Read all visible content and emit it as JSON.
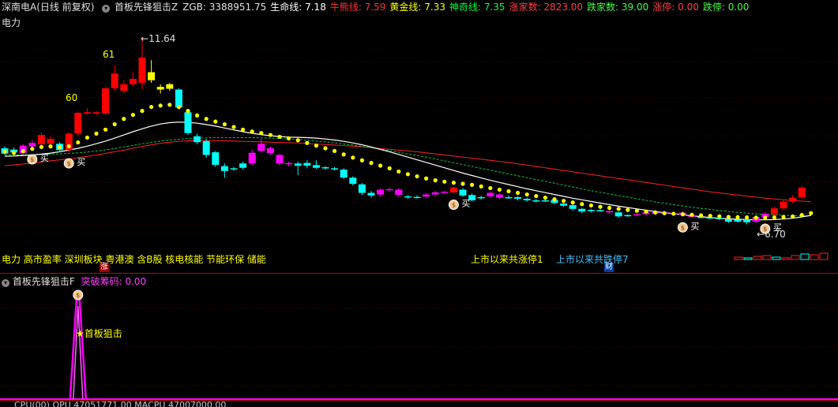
{
  "header": {
    "stock": "深南电A(日线 前复权)",
    "indicator_title": "首板先锋狙击Z",
    "items": [
      {
        "label": "ZGB:",
        "value": "3388951.75",
        "color": "#e0e0e0"
      },
      {
        "label": "生命线:",
        "value": "7.18",
        "color": "#ffffff"
      },
      {
        "label": "牛熊线:",
        "value": "7.59",
        "color": "#ff3030"
      },
      {
        "label": "黄金线:",
        "value": "7.33",
        "color": "#ffff00"
      },
      {
        "label": "神奇线:",
        "value": "7.35",
        "color": "#00ff40"
      },
      {
        "label": "涨家数:",
        "value": "2823.00",
        "color": "#ff4040"
      },
      {
        "label": "跌家数:",
        "value": "39.00",
        "color": "#40ff40"
      },
      {
        "label": "涨停:",
        "value": "0.00",
        "color": "#ff4040"
      },
      {
        "label": "跌停:",
        "value": "0.00",
        "color": "#40ff40"
      }
    ]
  },
  "sector_label": "电力",
  "concepts": "电力 高市盈率 深圳板块 粤港澳 含B股 核电核能 节能环保 储能",
  "limit_up_text": "上市以来共涨停1",
  "limit_down_text": "上市以来共跌停7",
  "zhang_badge": "涨",
  "cai_badge": "财",
  "annotations": {
    "high_label": "11.64",
    "low_label": "6.70",
    "label_61": "61",
    "label_60": "60",
    "buy": "买"
  },
  "sub_panel": {
    "title": "首板先锋狙击F",
    "item_label": "突破筹码:",
    "item_value": "0.00",
    "signal_label": "首板狙击"
  },
  "bottom_cut_text": "CPU(00) OPU 47051771.00 MACPU 47007000.00",
  "colors": {
    "up": "#ff0000",
    "down": "#00ffff",
    "magenta": "#ff00ff",
    "yellow": "#ffff00",
    "life_line": "#ffffff",
    "bull_bear": "#ff2020",
    "magic": "#00cc40",
    "separator": "#c80000"
  },
  "chart_data": {
    "type": "candlestick",
    "candles": [
      {
        "o": 7.35,
        "c": 7.55,
        "h": 7.62,
        "l": 7.3,
        "col": "cyan"
      },
      {
        "o": 7.5,
        "c": 7.4,
        "h": 7.58,
        "l": 7.32,
        "col": "cyan"
      },
      {
        "o": 7.35,
        "c": 7.65,
        "h": 7.7,
        "l": 7.3,
        "col": "magenta"
      },
      {
        "o": 7.62,
        "c": 7.75,
        "h": 7.85,
        "l": 7.55,
        "col": "magenta"
      },
      {
        "o": 7.7,
        "c": 8.05,
        "h": 8.15,
        "l": 7.65,
        "col": "red"
      },
      {
        "o": 7.9,
        "c": 7.72,
        "h": 8.0,
        "l": 7.62,
        "col": "red"
      },
      {
        "o": 7.72,
        "c": 7.48,
        "h": 7.78,
        "l": 7.4,
        "col": "cyan"
      },
      {
        "o": 7.48,
        "c": 8.1,
        "h": 8.15,
        "l": 7.4,
        "col": "red"
      },
      {
        "o": 8.1,
        "c": 8.88,
        "h": 8.93,
        "l": 8.0,
        "col": "red"
      },
      {
        "o": 8.85,
        "c": 8.9,
        "h": 9.05,
        "l": 8.8,
        "col": "red"
      },
      {
        "o": 8.9,
        "c": 8.85,
        "h": 8.95,
        "l": 8.8,
        "col": "red"
      },
      {
        "o": 8.85,
        "c": 9.8,
        "h": 9.85,
        "l": 8.8,
        "col": "red"
      },
      {
        "o": 9.8,
        "c": 10.35,
        "h": 10.65,
        "l": 9.7,
        "col": "red"
      },
      {
        "o": 9.7,
        "c": 9.95,
        "h": 10.1,
        "l": 9.6,
        "col": "red"
      },
      {
        "o": 10.15,
        "c": 9.95,
        "h": 10.4,
        "l": 9.85,
        "col": "red"
      },
      {
        "o": 10.0,
        "c": 10.95,
        "h": 11.64,
        "l": 9.75,
        "col": "red"
      },
      {
        "o": 10.4,
        "c": 10.1,
        "h": 10.85,
        "l": 10.0,
        "col": "yellow"
      },
      {
        "o": 9.75,
        "c": 9.85,
        "h": 9.95,
        "l": 9.6,
        "col": "yellow"
      },
      {
        "o": 9.78,
        "c": 9.95,
        "h": 10.0,
        "l": 9.7,
        "col": "yellow"
      },
      {
        "o": 9.75,
        "c": 9.08,
        "h": 9.8,
        "l": 9.0,
        "col": "cyan"
      },
      {
        "o": 8.9,
        "c": 8.12,
        "h": 8.95,
        "l": 8.05,
        "col": "cyan"
      },
      {
        "o": 8.0,
        "c": 7.78,
        "h": 8.1,
        "l": 7.7,
        "col": "cyan"
      },
      {
        "o": 7.82,
        "c": 7.3,
        "h": 7.9,
        "l": 7.2,
        "col": "cyan"
      },
      {
        "o": 7.4,
        "c": 6.93,
        "h": 7.45,
        "l": 6.85,
        "col": "cyan"
      },
      {
        "o": 6.88,
        "c": 6.7,
        "h": 6.98,
        "l": 6.45,
        "col": "cyan"
      },
      {
        "o": 6.8,
        "c": 6.8,
        "h": 6.85,
        "l": 6.7,
        "col": "cyan"
      },
      {
        "o": 6.82,
        "c": 6.98,
        "h": 7.05,
        "l": 6.75,
        "col": "cyan"
      },
      {
        "o": 6.98,
        "c": 7.38,
        "h": 7.5,
        "l": 6.9,
        "col": "magenta"
      },
      {
        "o": 7.45,
        "c": 7.72,
        "h": 7.9,
        "l": 7.4,
        "col": "magenta"
      },
      {
        "o": 7.55,
        "c": 7.37,
        "h": 7.62,
        "l": 7.3,
        "col": "magenta"
      },
      {
        "o": 7.3,
        "c": 6.98,
        "h": 7.35,
        "l": 6.9,
        "col": "magenta"
      },
      {
        "o": 7.0,
        "c": 6.95,
        "h": 7.05,
        "l": 6.88,
        "col": "magenta"
      },
      {
        "o": 6.98,
        "c": 6.9,
        "h": 7.05,
        "l": 6.55,
        "col": "cyan"
      },
      {
        "o": 6.9,
        "c": 7.0,
        "h": 7.1,
        "l": 6.8,
        "col": "cyan"
      },
      {
        "o": 6.92,
        "c": 6.82,
        "h": 7.1,
        "l": 6.78,
        "col": "cyan"
      },
      {
        "o": 6.84,
        "c": 6.8,
        "h": 6.88,
        "l": 6.75,
        "col": "cyan"
      },
      {
        "o": 6.8,
        "c": 6.78,
        "h": 6.85,
        "l": 6.72,
        "col": "cyan"
      },
      {
        "o": 6.75,
        "c": 6.45,
        "h": 6.8,
        "l": 6.4,
        "col": "cyan"
      },
      {
        "o": 6.45,
        "c": 6.22,
        "h": 6.5,
        "l": 6.15,
        "col": "cyan"
      },
      {
        "o": 6.2,
        "c": 5.88,
        "h": 6.25,
        "l": 5.8,
        "col": "cyan"
      },
      {
        "o": 5.88,
        "c": 5.78,
        "h": 5.95,
        "l": 5.7,
        "col": "cyan"
      },
      {
        "o": 5.82,
        "c": 6.0,
        "h": 6.05,
        "l": 5.75,
        "col": "magenta"
      },
      {
        "o": 6.0,
        "c": 6.02,
        "h": 6.08,
        "l": 5.95,
        "col": "magenta"
      },
      {
        "o": 6.0,
        "c": 5.8,
        "h": 6.05,
        "l": 5.75,
        "col": "magenta"
      },
      {
        "o": 5.75,
        "c": 5.72,
        "h": 5.8,
        "l": 5.65,
        "col": "cyan"
      },
      {
        "o": 5.72,
        "c": 5.73,
        "h": 5.78,
        "l": 5.67,
        "col": "cyan"
      },
      {
        "o": 5.74,
        "c": 5.82,
        "h": 5.88,
        "l": 5.7,
        "col": "magenta"
      },
      {
        "o": 5.82,
        "c": 5.9,
        "h": 5.95,
        "l": 5.78,
        "col": "magenta"
      },
      {
        "o": 5.9,
        "c": 5.92,
        "h": 5.96,
        "l": 5.85,
        "col": "magenta"
      },
      {
        "o": 5.9,
        "c": 6.08,
        "h": 6.1,
        "l": 5.85,
        "col": "red"
      },
      {
        "o": 6.0,
        "c": 5.78,
        "h": 6.05,
        "l": 5.73,
        "col": "cyan"
      },
      {
        "o": 5.8,
        "c": 5.6,
        "h": 5.85,
        "l": 5.55,
        "col": "cyan"
      },
      {
        "o": 5.68,
        "c": 5.72,
        "h": 5.78,
        "l": 5.64,
        "col": "cyan"
      },
      {
        "o": 5.75,
        "c": 5.88,
        "h": 5.92,
        "l": 5.7,
        "col": "magenta"
      },
      {
        "o": 5.82,
        "c": 5.7,
        "h": 5.86,
        "l": 5.64,
        "col": "magenta"
      },
      {
        "o": 5.7,
        "c": 5.72,
        "h": 5.78,
        "l": 5.65,
        "col": "cyan"
      },
      {
        "o": 5.72,
        "c": 5.66,
        "h": 5.76,
        "l": 5.6,
        "col": "cyan"
      },
      {
        "o": 5.66,
        "c": 5.6,
        "h": 5.7,
        "l": 5.55,
        "col": "cyan"
      },
      {
        "o": 5.6,
        "c": 5.58,
        "h": 5.65,
        "l": 5.52,
        "col": "cyan"
      },
      {
        "o": 5.58,
        "c": 5.6,
        "h": 5.64,
        "l": 5.54,
        "col": "cyan"
      },
      {
        "o": 5.62,
        "c": 5.5,
        "h": 5.66,
        "l": 5.46,
        "col": "cyan"
      },
      {
        "o": 5.48,
        "c": 5.4,
        "h": 5.52,
        "l": 5.35,
        "col": "cyan"
      },
      {
        "o": 5.42,
        "c": 5.28,
        "h": 5.46,
        "l": 5.22,
        "col": "cyan"
      },
      {
        "o": 5.28,
        "c": 5.18,
        "h": 5.32,
        "l": 5.12,
        "col": "cyan"
      },
      {
        "o": 5.2,
        "c": 5.24,
        "h": 5.28,
        "l": 5.15,
        "col": "cyan"
      },
      {
        "o": 5.22,
        "c": 5.23,
        "h": 5.28,
        "l": 5.18,
        "col": "cyan"
      },
      {
        "o": 5.2,
        "c": 5.15,
        "h": 5.25,
        "l": 5.1,
        "col": "magenta"
      },
      {
        "o": 5.15,
        "c": 5.0,
        "h": 5.18,
        "l": 4.95,
        "col": "cyan"
      },
      {
        "o": 5.02,
        "c": 5.05,
        "h": 5.08,
        "l": 4.98,
        "col": "cyan"
      },
      {
        "o": 5.05,
        "c": 5.08,
        "h": 5.12,
        "l": 5.0,
        "col": "magenta"
      },
      {
        "o": 5.08,
        "c": 5.15,
        "h": 5.18,
        "l": 5.04,
        "col": "magenta"
      },
      {
        "o": 5.15,
        "c": 5.1,
        "h": 5.19,
        "l": 5.05,
        "col": "magenta"
      },
      {
        "o": 5.12,
        "c": 5.14,
        "h": 5.17,
        "l": 5.08,
        "col": "magenta"
      },
      {
        "o": 5.1,
        "c": 5.12,
        "h": 5.16,
        "l": 5.06,
        "col": "magenta"
      },
      {
        "o": 5.14,
        "c": 5.05,
        "h": 5.18,
        "l": 5.0,
        "col": "magenta"
      },
      {
        "o": 5.02,
        "c": 4.98,
        "h": 5.08,
        "l": 4.95,
        "col": "magenta"
      },
      {
        "o": 4.98,
        "c": 4.98,
        "h": 5.03,
        "l": 4.93,
        "col": "cyan"
      },
      {
        "o": 4.96,
        "c": 4.95,
        "h": 5.0,
        "l": 4.9,
        "col": "cyan"
      },
      {
        "o": 4.94,
        "c": 4.9,
        "h": 4.98,
        "l": 4.86,
        "col": "cyan"
      },
      {
        "o": 4.9,
        "c": 4.8,
        "h": 4.94,
        "l": 4.76,
        "col": "cyan"
      },
      {
        "o": 4.8,
        "c": 4.88,
        "h": 4.92,
        "l": 4.76,
        "col": "cyan"
      },
      {
        "o": 4.88,
        "c": 4.78,
        "h": 4.92,
        "l": 4.7,
        "col": "cyan"
      },
      {
        "o": 4.8,
        "c": 4.98,
        "h": 5.05,
        "l": 4.77,
        "col": "magenta"
      },
      {
        "o": 4.98,
        "c": 5.1,
        "h": 5.15,
        "l": 4.95,
        "col": "magenta"
      },
      {
        "o": 5.08,
        "c": 5.3,
        "h": 5.36,
        "l": 5.04,
        "col": "red"
      },
      {
        "o": 5.3,
        "c": 5.55,
        "h": 5.6,
        "l": 5.25,
        "col": "red"
      },
      {
        "o": 5.55,
        "c": 5.7,
        "h": 5.78,
        "l": 5.5,
        "col": "red"
      },
      {
        "o": 5.72,
        "c": 6.08,
        "h": 6.12,
        "l": 5.65,
        "col": "red"
      }
    ],
    "golden_line": [
      7.42,
      7.38,
      7.45,
      7.53,
      7.6,
      7.62,
      7.6,
      7.63,
      7.77,
      7.95,
      8.1,
      8.25,
      8.45,
      8.65,
      8.8,
      8.95,
      9.1,
      9.15,
      9.18,
      9.1,
      8.95,
      8.78,
      8.65,
      8.55,
      8.45,
      8.35,
      8.25,
      8.18,
      8.12,
      8.05,
      7.98,
      7.92,
      7.85,
      7.75,
      7.65,
      7.55,
      7.45,
      7.32,
      7.2,
      7.1,
      7.0,
      6.9,
      6.8,
      6.68,
      6.58,
      6.5,
      6.42,
      6.35,
      6.3,
      6.26,
      6.22,
      6.18,
      6.12,
      6.06,
      6.0,
      5.94,
      5.88,
      5.82,
      5.76,
      5.7,
      5.64,
      5.58,
      5.52,
      5.46,
      5.41,
      5.36,
      5.32,
      5.28,
      5.24,
      5.21,
      5.18,
      5.15,
      5.12,
      5.1,
      5.08,
      5.06,
      5.04,
      5.02,
      5.0,
      4.98,
      4.97,
      4.96,
      4.95,
      4.95,
      4.96,
      4.98,
      5.0,
      5.05,
      5.12
    ],
    "life_line": [
      7.25,
      7.26,
      7.28,
      7.3,
      7.33,
      7.37,
      7.42,
      7.48,
      7.55,
      7.63,
      7.72,
      7.82,
      7.93,
      8.05,
      8.17,
      8.28,
      8.38,
      8.46,
      8.51,
      8.53,
      8.52,
      8.49,
      8.44,
      8.38,
      8.31,
      8.24,
      8.17,
      8.11,
      8.06,
      8.02,
      7.99,
      7.97,
      7.96,
      7.95,
      7.93,
      7.9,
      7.86,
      7.81,
      7.75,
      7.68,
      7.6,
      7.51,
      7.42,
      7.32,
      7.22,
      7.12,
      7.02,
      6.92,
      6.82,
      6.72,
      6.62,
      6.53,
      6.44,
      6.35,
      6.27,
      6.19,
      6.11,
      6.03,
      5.96,
      5.89,
      5.82,
      5.75,
      5.68,
      5.62,
      5.56,
      5.5,
      5.44,
      5.38,
      5.33,
      5.28,
      5.23,
      5.18,
      5.14,
      5.1,
      5.06,
      5.02,
      4.99,
      4.96,
      4.93,
      4.91,
      4.89,
      4.88,
      4.87,
      4.87,
      4.88,
      4.9,
      4.93,
      4.98,
      5.04
    ],
    "magic_line": [
      7.3,
      7.3,
      7.3,
      7.31,
      7.32,
      7.33,
      7.34,
      7.36,
      7.38,
      7.41,
      7.45,
      7.49,
      7.54,
      7.6,
      7.66,
      7.72,
      7.77,
      7.82,
      7.86,
      7.89,
      7.92,
      7.93,
      7.94,
      7.95,
      7.95,
      7.95,
      7.95,
      7.95,
      7.94,
      7.93,
      7.92,
      7.9,
      7.88,
      7.85,
      7.82,
      7.79,
      7.75,
      7.71,
      7.67,
      7.62,
      7.57,
      7.52,
      7.46,
      7.4,
      7.34,
      7.28,
      7.22,
      7.15,
      7.08,
      7.01,
      6.94,
      6.87,
      6.8,
      6.73,
      6.66,
      6.59,
      6.52,
      6.45,
      6.38,
      6.31,
      6.24,
      6.17,
      6.1,
      6.03,
      5.96,
      5.9,
      5.84,
      5.78,
      5.72,
      5.66,
      5.6,
      5.54,
      5.49,
      5.44,
      5.39,
      5.34,
      5.3,
      5.26,
      5.22,
      5.18,
      5.15,
      5.12,
      5.09,
      5.07,
      5.05,
      5.04,
      5.03,
      5.02,
      5.02
    ],
    "bull_bear_line": [
      6.9,
      6.93,
      6.96,
      7.0,
      7.04,
      7.08,
      7.12,
      7.16,
      7.2,
      7.25,
      7.3,
      7.36,
      7.42,
      7.48,
      7.55,
      7.62,
      7.68,
      7.74,
      7.78,
      7.81,
      7.83,
      7.84,
      7.84,
      7.84,
      7.83,
      7.82,
      7.81,
      7.8,
      7.79,
      7.78,
      7.77,
      7.76,
      7.75,
      7.73,
      7.71,
      7.69,
      7.67,
      7.65,
      7.63,
      7.6,
      7.57,
      7.54,
      7.51,
      7.48,
      7.45,
      7.42,
      7.38,
      7.34,
      7.3,
      7.26,
      7.22,
      7.18,
      7.14,
      7.1,
      7.06,
      7.02,
      6.97,
      6.92,
      6.87,
      6.82,
      6.77,
      6.72,
      6.67,
      6.62,
      6.57,
      6.52,
      6.47,
      6.42,
      6.37,
      6.32,
      6.27,
      6.22,
      6.17,
      6.12,
      6.07,
      6.02,
      5.97,
      5.92,
      5.88,
      5.84,
      5.8,
      5.76,
      5.72,
      5.68,
      5.65,
      5.62,
      5.59,
      5.57,
      5.55
    ],
    "buy_signal_indices": [
      3,
      7,
      49,
      74,
      83
    ],
    "ylim": [
      4.3,
      12.1
    ],
    "sub_signal": {
      "index": 8,
      "peak": 1.0
    }
  }
}
